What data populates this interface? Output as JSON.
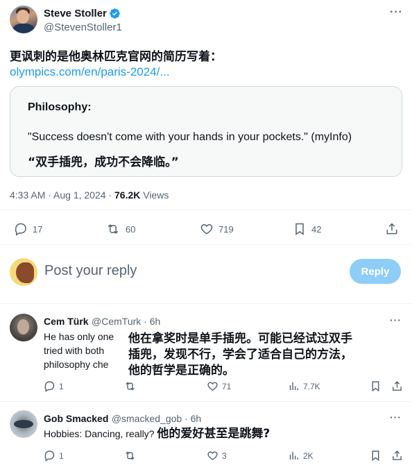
{
  "main_tweet": {
    "author_name": "Steve Stoller",
    "author_handle": "@StevenStoller1",
    "text": "更讽刺的是他奥林匹克官网的简历写着：",
    "link": "olympics.com/en/paris-2024/...",
    "card": {
      "title": "Philosophy:",
      "quote": "\"Success doesn't come with your hands in your pockets.\" (myInfo)",
      "translation": "“双手插兜，成功不会降临。”"
    },
    "time": "4:33 AM · Aug 1, 2024 · ",
    "views_count": "76.2K",
    "views_label": " Views",
    "actions": {
      "replies": "17",
      "retweets": "60",
      "likes": "719",
      "bookmarks": "42"
    }
  },
  "reply_box": {
    "placeholder": "Post your reply",
    "button": "Reply"
  },
  "comments": [
    {
      "name": "Cem Türk",
      "handle": "@CemTurk · 6h",
      "lines": [
        "He has only one",
        "tried with both",
        "philosophy che"
      ],
      "translation_lines": [
        "他在拿奖时是单手插兜。可能已经试过双手",
        "插兜，发现不行，学会了适合自己的方法，",
        "他的哲学是正确的。"
      ],
      "actions": {
        "replies": "1",
        "likes": "71",
        "views": "7.7K"
      }
    },
    {
      "name": "Gob Smacked",
      "handle": "@smacked_gob · 6h",
      "text": "Hobbies: Dancing, really?",
      "translation": "他的爱好甚至是跳舞?",
      "actions": {
        "replies": "1",
        "likes": "3",
        "views": "2K"
      }
    }
  ],
  "colors": {
    "accent": "#1d9bf0",
    "muted": "#536471",
    "reply_button": "#8ecdf8"
  }
}
